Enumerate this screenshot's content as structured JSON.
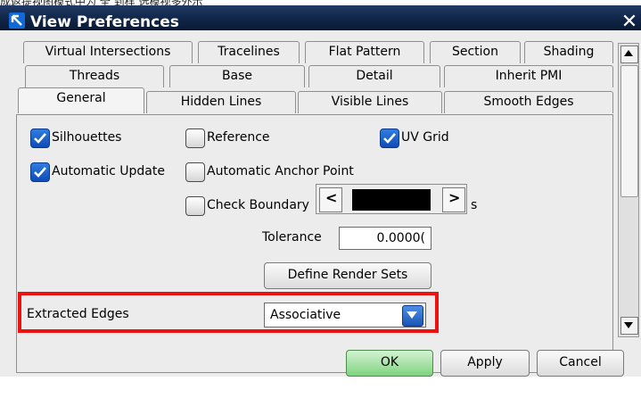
{
  "window": {
    "title": "View Preferences",
    "close_glyph": "✕",
    "background_text": "成返提视图模式中为 全 到样 选模视多外示"
  },
  "tabs": {
    "row1": [
      "Virtual Intersections",
      "Tracelines",
      "Flat Pattern",
      "Section",
      "Shading"
    ],
    "row2": [
      "Threads",
      "Base",
      "Detail",
      "Inherit PMI"
    ],
    "row3": [
      "General",
      "Hidden Lines",
      "Visible Lines",
      "Smooth Edges"
    ],
    "active": "General"
  },
  "options": {
    "silhouettes": {
      "label": "Silhouettes",
      "checked": true
    },
    "reference": {
      "label": "Reference",
      "checked": false
    },
    "uv_grid": {
      "label": "UV Grid",
      "checked": true
    },
    "automatic_update": {
      "label": "Automatic Update",
      "checked": true
    },
    "automatic_anchor_point": {
      "label": "Automatic Anchor Point",
      "checked": false
    },
    "check_boundary": {
      "label": "Check Boundary",
      "checked": false
    },
    "partial_hidden_suffix": "s"
  },
  "tolerance": {
    "label": "Tolerance",
    "value": "0.0000("
  },
  "buttons": {
    "define_render_sets": "Define Render Sets",
    "ok": "OK",
    "apply": "Apply",
    "cancel": "Cancel"
  },
  "extracted_edges": {
    "label": "Extracted Edges",
    "value": "Associative"
  },
  "popup": {
    "left_arrow": "<",
    "right_arrow": ">"
  },
  "colors": {
    "title_bar": "#0f2446",
    "checkbox_checked": "#1f66cc",
    "highlight_border": "#ee1111",
    "ok_button": "#7fd37f"
  }
}
